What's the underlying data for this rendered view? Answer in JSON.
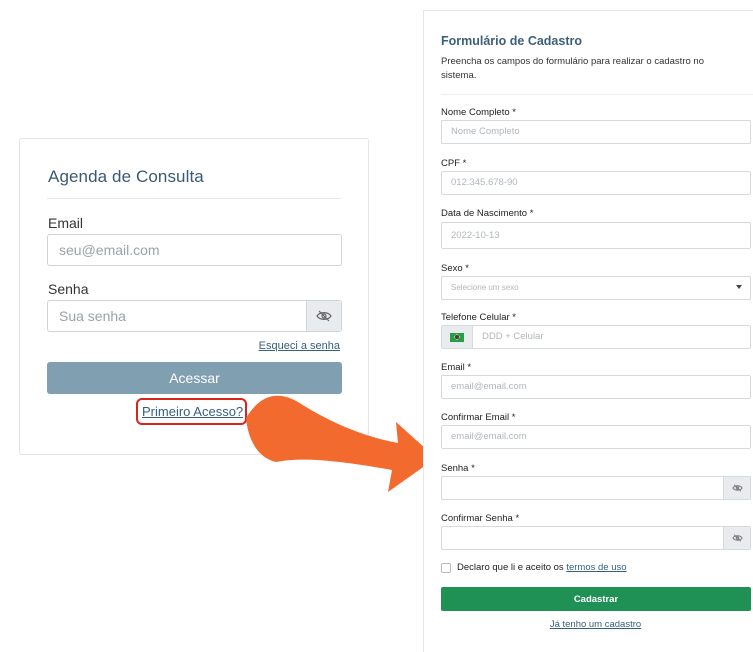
{
  "login": {
    "title": "Agenda de Consulta",
    "email_label": "Email",
    "email_placeholder": "seu@email.com",
    "password_label": "Senha",
    "password_placeholder": "Sua senha",
    "forgot_link": "Esqueci a senha",
    "submit_label": "Acessar",
    "first_access_link": "Primeiro Acesso?"
  },
  "register": {
    "title": "Formulário de Cadastro",
    "subtitle": "Preencha os campos do formulário para realizar o cadastro no sistema.",
    "fields": {
      "name": {
        "label": "Nome Completo *",
        "placeholder": "Nome Completo"
      },
      "cpf": {
        "label": "CPF *",
        "placeholder": "012.345.678-90"
      },
      "birth": {
        "label": "Data de Nascimento *",
        "placeholder": "2022-10-13"
      },
      "sex": {
        "label": "Sexo *",
        "placeholder": "Selecione um sexo"
      },
      "phone": {
        "label": "Telefone Celular *",
        "placeholder": "DDD + Celular"
      },
      "email": {
        "label": "Email *",
        "placeholder": "email@email.com"
      },
      "email_confirm": {
        "label": "Confirmar Email *",
        "placeholder": "email@email.com"
      },
      "password": {
        "label": "Senha *",
        "placeholder": ""
      },
      "password_confirm": {
        "label": "Confirmar Senha *",
        "placeholder": ""
      }
    },
    "terms_text": "Declaro que li e aceito os ",
    "terms_link": "termos de uso",
    "submit_label": "Cadastrar",
    "have_account_link": "Já tenho um cadastro"
  },
  "colors": {
    "login_title": "#3a5a74",
    "access_button": "#809fb0",
    "highlight_box": "#d7261e",
    "arrow": "#f26a2e",
    "register_button": "#1f9155",
    "link": "#35607e"
  },
  "icons": {
    "password_toggle": "eye-slash-icon",
    "flag": "brazil-flag-icon",
    "arrow": "curved-arrow-icon"
  }
}
